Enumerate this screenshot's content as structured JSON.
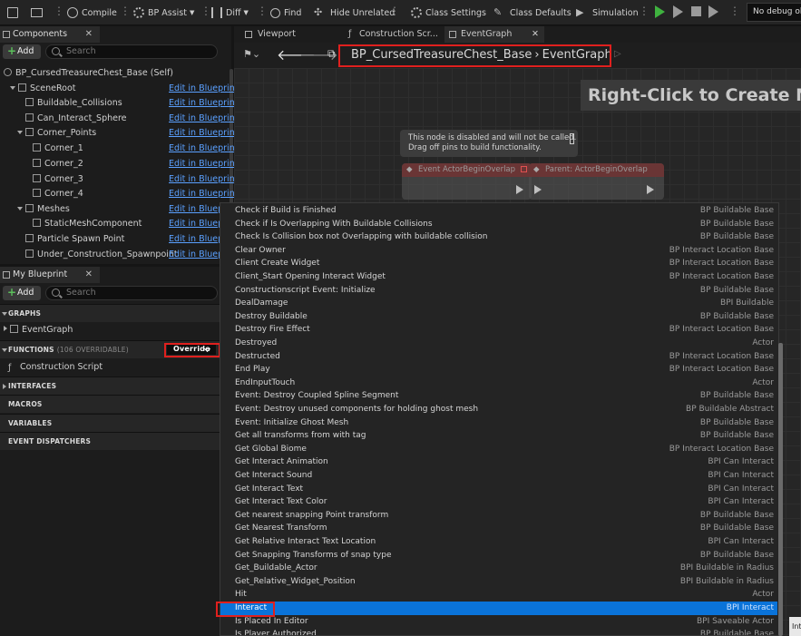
{
  "toolbar": {
    "compile": "Compile",
    "bp_assist": "BP Assist",
    "diff": "Diff",
    "find": "Find",
    "hide_unrelated": "Hide Unrelated",
    "class_settings": "Class Settings",
    "class_defaults": "Class Defaults",
    "simulation": "Simulation",
    "debug_object": "No debug obj"
  },
  "components": {
    "tab_label": "Components",
    "add_label": "Add",
    "search_placeholder": "Search",
    "self_label": "BP_CursedTreasureChest_Base (Self)",
    "edit_label": "Edit in Blueprint",
    "tree": [
      {
        "label": "SceneRoot"
      },
      {
        "label": "Buildable_Collisions"
      },
      {
        "label": "Can_Interact_Sphere"
      },
      {
        "label": "Corner_Points"
      },
      {
        "label": "Corner_1"
      },
      {
        "label": "Corner_2"
      },
      {
        "label": "Corner_3"
      },
      {
        "label": "Corner_4"
      },
      {
        "label": "Meshes"
      },
      {
        "label": "StaticMeshComponent"
      },
      {
        "label": "Particle Spawn Point"
      },
      {
        "label": "Under_Construction_Spawnpoint"
      }
    ]
  },
  "my_blueprint": {
    "tab_label": "My Blueprint",
    "add_label": "Add",
    "search_placeholder": "Search",
    "graphs_header": "GRAPHS",
    "event_graph": "EventGraph",
    "functions_header": "FUNCTIONS",
    "functions_count": "(106 OVERRIDABLE)",
    "override_label": "Override",
    "construction_script": "Construction Script",
    "interfaces_header": "INTERFACES",
    "macros_header": "MACROS",
    "variables_header": "VARIABLES",
    "dispatchers_header": "EVENT DISPATCHERS"
  },
  "graph": {
    "tabs": [
      "Viewport",
      "Construction Scr...",
      "EventGraph"
    ],
    "breadcrumb_blueprint": "BP_CursedTreasureChest_Base",
    "breadcrumb_graph": "EventGraph",
    "watermark": "Right-Click to Create New",
    "disabled_note_line1": "This node is disabled and will not be called.",
    "disabled_note_line2": "Drag off pins to build functionality.",
    "node1_title": "Event ActorBeginOverlap",
    "node2_title": "Parent: ActorBeginOverlap"
  },
  "menu": {
    "items": [
      {
        "label": "Check if Build is Finished",
        "source": "BP Buildable Base"
      },
      {
        "label": "Check if Is Overlapping With Buildable Collisions",
        "source": "BP Buildable Base"
      },
      {
        "label": "Check Is Collision box not Overlapping with buildable collision",
        "source": "BP Buildable Base"
      },
      {
        "label": "Clear Owner",
        "source": "BP Interact Location Base"
      },
      {
        "label": "Client Create Widget",
        "source": "BP Interact Location Base"
      },
      {
        "label": "Client_Start Opening Interact Widget",
        "source": "BP Interact Location Base"
      },
      {
        "label": "Constructionscript Event: Initialize",
        "source": "BP Buildable Base"
      },
      {
        "label": "DealDamage",
        "source": "BPI Buildable"
      },
      {
        "label": "Destroy Buildable",
        "source": "BP Buildable Base"
      },
      {
        "label": "Destroy Fire Effect",
        "source": "BP Interact Location Base"
      },
      {
        "label": "Destroyed",
        "source": "Actor"
      },
      {
        "label": "Destructed",
        "source": "BP Interact Location Base"
      },
      {
        "label": "End Play",
        "source": "BP Interact Location Base"
      },
      {
        "label": "EndInputTouch",
        "source": "Actor"
      },
      {
        "label": "Event: Destroy Coupled Spline Segment",
        "source": "BP Buildable Base"
      },
      {
        "label": "Event: Destroy unused components for holding ghost mesh",
        "source": "BP Buildable Abstract"
      },
      {
        "label": "Event: Initialize Ghost Mesh",
        "source": "BP Buildable Base"
      },
      {
        "label": "Get all transforms from with tag",
        "source": "BP Buildable Base"
      },
      {
        "label": "Get Global Biome",
        "source": "BP Interact Location Base"
      },
      {
        "label": "Get Interact Animation",
        "source": "BPI Can Interact"
      },
      {
        "label": "Get Interact Sound",
        "source": "BPI Can Interact"
      },
      {
        "label": "Get Interact Text",
        "source": "BPI Can Interact"
      },
      {
        "label": "Get Interact Text Color",
        "source": "BPI Can Interact"
      },
      {
        "label": "Get nearest snapping Point transform",
        "source": "BP Buildable Base"
      },
      {
        "label": "Get Nearest Transform",
        "source": "BP Buildable Base"
      },
      {
        "label": "Get Relative Interact Text Location",
        "source": "BPI Can Interact"
      },
      {
        "label": "Get Snapping Transforms of snap type",
        "source": "BP Buildable Base"
      },
      {
        "label": "Get_Buildable_Actor",
        "source": "BPI Buildable in Radius"
      },
      {
        "label": "Get_Relative_Widget_Position",
        "source": "BPI Buildable in Radius"
      },
      {
        "label": "Hit",
        "source": "Actor"
      },
      {
        "label": "Interact",
        "source": "BPI Interact"
      },
      {
        "label": "Is Placed In Editor",
        "source": "BPI Saveable Actor"
      },
      {
        "label": "Is Player Authorized",
        "source": "BP Buildable Base"
      }
    ],
    "selected_index": 30
  },
  "tooltip_fragment": "Int",
  "colors": {
    "highlight": "#e0201e",
    "selection": "#0a73d9",
    "link": "#5aa0ff",
    "play": "#3fb23f"
  }
}
